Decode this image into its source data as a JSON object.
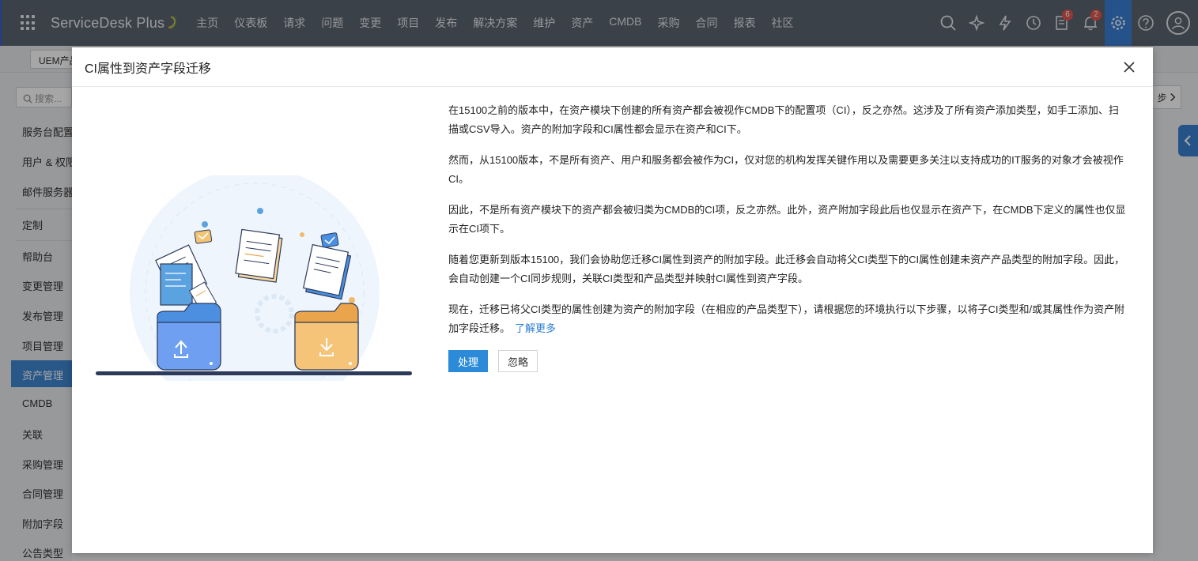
{
  "app": {
    "brand": "ServiceDesk Plus",
    "nav": [
      "主页",
      "仪表板",
      "请求",
      "问题",
      "变更",
      "项目",
      "发布",
      "解决方案",
      "维护",
      "资产",
      "CMDB",
      "采购",
      "合同",
      "报表",
      "社区"
    ],
    "badges": {
      "tasks": "6",
      "notifications": "2"
    },
    "product_select": "UEM产品"
  },
  "sidebar": {
    "search_placeholder": "搜索...",
    "items": [
      "服务台配置",
      "用户 & 权限",
      "邮件服务器",
      "定制",
      "帮助台",
      "变更管理",
      "发布管理",
      "项目管理",
      "资产管理",
      "CMDB",
      "关联",
      "采购管理",
      "合同管理",
      "附加字段",
      "公告类型"
    ],
    "active_index": 8
  },
  "right_panel": {
    "next_label": "步"
  },
  "modal": {
    "title": "CI属性到资产字段迁移",
    "paragraphs": [
      "在15100之前的版本中，在资产模块下创建的所有资产都会被视作CMDB下的配置项（CI），反之亦然。这涉及了所有资产添加类型，如手工添加、扫描或CSV导入。资产的附加字段和CI属性都会显示在资产和CI下。",
      "然而，从15100版本，不是所有资产、用户和服务都会被作为CI，仅对您的机构发挥关键作用以及需要更多关注以支持成功的IT服务的对象才会被视作CI。",
      "因此，不是所有资产模块下的资产都会被归类为CMDB的CI项，反之亦然。此外，资产附加字段此后也仅显示在资产下，在CMDB下定义的属性也仅显示在CI项下。",
      "随着您更新到版本15100，我们会协助您迁移CI属性到资产的附加字段。此迁移会自动将父CI类型下的CI属性创建未资产产品类型的附加字段。因此，会自动创建一个CI同步规则，关联CI类型和产品类型并映射CI属性到资产字段。"
    ],
    "last_paragraph": "现在，迁移已将父CI类型的属性创建为资产的附加字段（在相应的产品类型下），请根据您的环境执行以下步骤，以将子CI类型和/或其属性作为资产附加字段迁移。",
    "learn_more": "了解更多",
    "process_button": "处理",
    "ignore_button": "忽略"
  },
  "colors": {
    "nav_bg": "#5b6470",
    "primary": "#2b8bd9",
    "active_side": "#3f86d1"
  }
}
